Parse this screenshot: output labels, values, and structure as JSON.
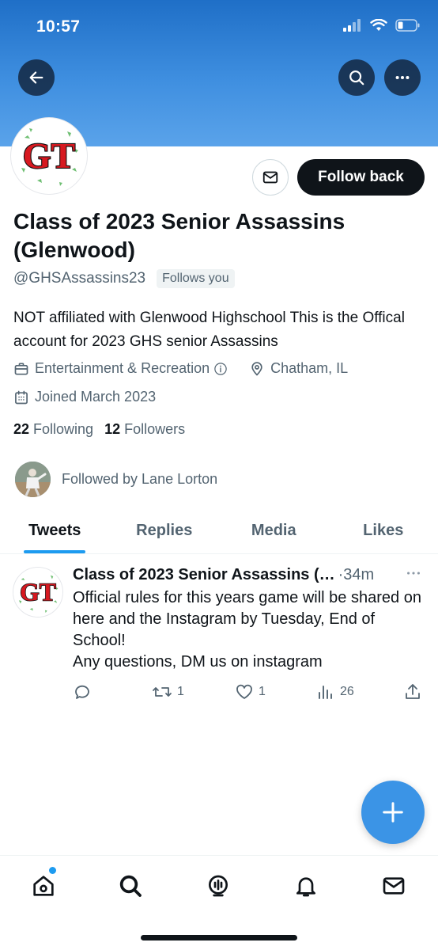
{
  "status": {
    "time": "10:57"
  },
  "profile": {
    "name": "Class of 2023 Senior Assassins (Glenwood)",
    "handle": "@GHSAssassins23",
    "follows_you": "Follows you",
    "follow_button": "Follow back",
    "bio": "NOT affiliated with Glenwood Highschool This is the Offical account for 2023 GHS senior Assassins",
    "category": "Entertainment & Recreation",
    "location": "Chatham, IL",
    "joined": "Joined March 2023",
    "following_count": "22",
    "following_label": "Following",
    "followers_count": "12",
    "followers_label": "Followers",
    "followed_by": "Followed by Lane Lorton",
    "avatar_text": "GT"
  },
  "tabs": [
    {
      "label": "Tweets",
      "active": true
    },
    {
      "label": "Replies",
      "active": false
    },
    {
      "label": "Media",
      "active": false
    },
    {
      "label": "Likes",
      "active": false
    }
  ],
  "tweet": {
    "author": "Class of 2023 Senior Assassins (…",
    "time": "·34m",
    "text": "Official rules for this years game will be shared on here and the Instagram by Tuesday, End of School!\nAny questions, DM us on instagram",
    "retweets": "1",
    "likes": "1",
    "views": "26"
  },
  "colors": {
    "accent": "#1d9bf0",
    "banner": "#3f8fe0",
    "logo_red": "#d71920"
  },
  "icons": {
    "back": "arrow-left-icon",
    "search": "search-icon",
    "more": "more-horizontal-icon",
    "message": "envelope-icon",
    "category": "briefcase-icon",
    "location": "map-pin-icon",
    "joined": "calendar-icon",
    "nav": [
      "home-icon",
      "explore-icon",
      "spaces-icon",
      "bell-icon",
      "mail-icon"
    ]
  }
}
